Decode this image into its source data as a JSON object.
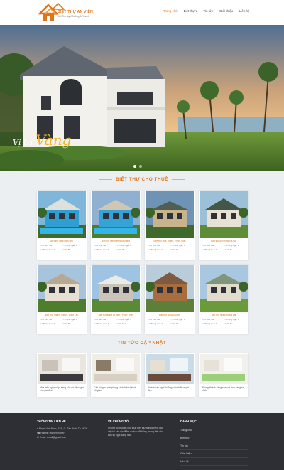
{
  "header": {
    "logo_title": "BIỆT THỰ AN VIÊN",
    "logo_sub": "Biệt Thự Nghỉ Dưỡng & Resort"
  },
  "nav": {
    "items": [
      "Trang chủ",
      "Biệt thự",
      "Tin tức",
      "Giới thiệu",
      "Liên hệ"
    ],
    "active": "Trang chủ"
  },
  "hero": {
    "caption_1": "Vị trí",
    "caption_2": "Vàng",
    "slides": 2,
    "active_slide": 1
  },
  "villas_section": {
    "title": "BIỆT THỰ CHO THUÊ",
    "cards": [
      {
        "title": "Biệt thự view biển đẹp",
        "area": "Dt: 315 m2",
        "rooms": "Phòng ngủ: 3",
        "bath": "Phòng tắm: 2",
        "price": "Giá: 8tr"
      },
      {
        "title": "Biệt thự ven biển Nha Trang",
        "area": "Dt: 250 m2",
        "rooms": "Phòng ngủ: 4",
        "bath": "Phòng tắm: 3",
        "price": "Giá: 9tr"
      },
      {
        "title": "Biệt thự Hoa Thiên - Phan Thiết",
        "area": "Dt: 275 m2",
        "rooms": "Phòng ngủ: 3",
        "bath": "Phòng tắm: 2",
        "price": "Giá: 7tr"
      },
      {
        "title": "Biệt thự đồi thông Đà Lạt",
        "area": "Dt: 180 m2",
        "rooms": "Phòng ngủ: 3",
        "bath": "Phòng tắm: 2",
        "price": "Giá: 6tr"
      },
      {
        "title": "Biệt thự Thanh Thiên - Vũng Tàu",
        "area": "Dt: 225 m2",
        "rooms": "Phòng ngủ: 4",
        "bath": "Phòng tắm: 3",
        "price": "Giá: 8tr"
      },
      {
        "title": "Biệt thự trắng cổ điển - Phan Thiết",
        "area": "Dt: 320 m2",
        "rooms": "Phòng ngủ: 5",
        "bath": "Phòng tắm: 4",
        "price": "Giá: 10tr"
      },
      {
        "title": "Biệt thự gỗ sân vườn",
        "area": "Dt: 210 m2",
        "rooms": "Phòng ngủ: 3",
        "bath": "Phòng tắm: 2",
        "price": "Giá: 7tr"
      },
      {
        "title": "Biệt thự nhà kính Đà Lạt",
        "area": "Dt: 185 m2",
        "rooms": "Phòng ngủ: 3",
        "bath": "Phòng tắm: 2",
        "price": "Giá: 6tr"
      }
    ]
  },
  "news_section": {
    "title": "TIN TỨC CẬP NHẬT",
    "items": [
      "Nhà bếp ngăn nắp, sáng sủa và tiện nghi cho gia đình",
      "Căn hộ gác mái phong cách hiện đại và tối giản",
      "Khách sạn nghỉ dưỡng view biển tuyệt đẹp",
      "Phòng khách sáng sủa với ánh sáng tự nhiên"
    ]
  },
  "footer": {
    "contact": {
      "heading": "THÔNG TIN LIÊN HỆ",
      "address": "Phạm Văn Bạch, P.15, Q. Tân Bình, Tp. HCM",
      "hotline": "Hotline: 0989 999 999",
      "email": "Email: email@gmail.com"
    },
    "about": {
      "heading": "VỀ CHÚNG TÔI",
      "text": "Chúng tôi chuyên cho thuê biệt thự nghỉ dưỡng cao cấp tại các địa điểm du lịch nổi tiếng, mang đến cho bạn kỳ nghỉ đáng nhớ."
    },
    "categories": {
      "heading": "DANH MỤC",
      "items": [
        "Trang chủ",
        "Biệt thự",
        "Tin tức",
        "Giới thiệu",
        "Liên hệ"
      ]
    }
  },
  "colors": {
    "accent": "#e0761b",
    "footer_bg": "#2e2f35",
    "page_bg": "#eceff2"
  }
}
